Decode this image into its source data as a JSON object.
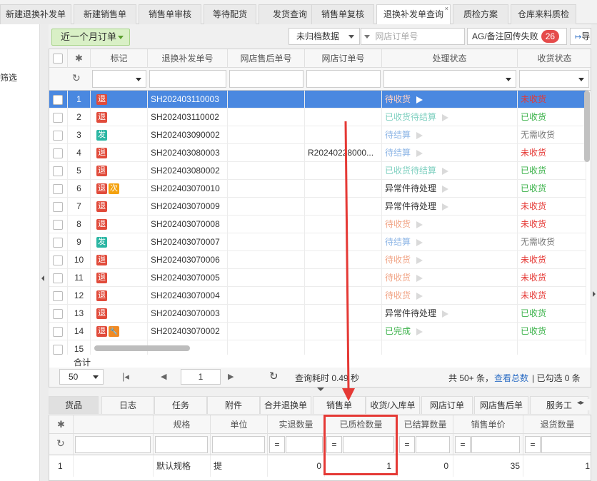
{
  "top_tabs": [
    {
      "label": "新建退换补发单"
    },
    {
      "label": "新建销售单"
    },
    {
      "label": "销售单审核"
    },
    {
      "label": "等待配货"
    },
    {
      "label": "发货查询"
    },
    {
      "label": "销售单复核"
    },
    {
      "label": "退换补发单查询",
      "active": true
    },
    {
      "label": "质检方案"
    },
    {
      "label": "仓库来料质检"
    }
  ],
  "close_glyph": "×",
  "left_panel": {
    "label": "筛选"
  },
  "toolbar": {
    "period_label": "近一个月订单",
    "archive_select": "未归档数据",
    "order_search_placeholder": "网店订单号",
    "ag_label": "AG/备注回传失败",
    "ag_count": "26",
    "right_button_label": "导"
  },
  "table": {
    "headers": {
      "mark": "标记",
      "order_no": "退换补发单号",
      "after_sale_no": "网店售后单号",
      "web_order_no": "网店订单号",
      "process_status": "处理状态",
      "receipt_status": "收货状态"
    },
    "tag_colors": {
      "退": "#e14b3b",
      "发": "#2bb6a3",
      "次": "#f4a20f",
      "wrench": "#f08a24"
    },
    "status_colors": {
      "待收货": "#f1a586",
      "已收货待结算": "#7fd0c0",
      "待结算": "#8eb6e6",
      "异常件待处理": "#333333",
      "已完成": "#3bb24a",
      "未收货": "#e53935",
      "已收货": "#3bb24a",
      "无需收货": "#777777"
    },
    "rows": [
      {
        "num": "1",
        "tags": [
          "退"
        ],
        "order_no": "SH202403110003",
        "after_sale_no": "",
        "web_order_no": "",
        "status": "待收货",
        "receipt": "未收货",
        "selected": true
      },
      {
        "num": "2",
        "tags": [
          "退"
        ],
        "order_no": "SH202403110002",
        "after_sale_no": "",
        "web_order_no": "",
        "status": "已收货待结算",
        "receipt": "已收货"
      },
      {
        "num": "3",
        "tags": [
          "发"
        ],
        "order_no": "SH202403090002",
        "after_sale_no": "",
        "web_order_no": "",
        "status": "待结算",
        "receipt": "无需收货"
      },
      {
        "num": "4",
        "tags": [
          "退"
        ],
        "order_no": "SH202403080003",
        "after_sale_no": "",
        "web_order_no": "R20240228000...",
        "status": "待结算",
        "receipt": "未收货"
      },
      {
        "num": "5",
        "tags": [
          "退"
        ],
        "order_no": "SH202403080002",
        "after_sale_no": "",
        "web_order_no": "",
        "status": "已收货待结算",
        "receipt": "已收货"
      },
      {
        "num": "6",
        "tags": [
          "退",
          "次"
        ],
        "order_no": "SH202403070010",
        "after_sale_no": "",
        "web_order_no": "",
        "status": "异常件待处理",
        "receipt": "已收货"
      },
      {
        "num": "7",
        "tags": [
          "退"
        ],
        "order_no": "SH202403070009",
        "after_sale_no": "",
        "web_order_no": "",
        "status": "异常件待处理",
        "receipt": "未收货"
      },
      {
        "num": "8",
        "tags": [
          "退"
        ],
        "order_no": "SH202403070008",
        "after_sale_no": "",
        "web_order_no": "",
        "status": "待收货",
        "receipt": "未收货"
      },
      {
        "num": "9",
        "tags": [
          "发"
        ],
        "order_no": "SH202403070007",
        "after_sale_no": "",
        "web_order_no": "",
        "status": "待结算",
        "receipt": "无需收货"
      },
      {
        "num": "10",
        "tags": [
          "退"
        ],
        "order_no": "SH202403070006",
        "after_sale_no": "",
        "web_order_no": "",
        "status": "待收货",
        "receipt": "未收货"
      },
      {
        "num": "11",
        "tags": [
          "退"
        ],
        "order_no": "SH202403070005",
        "after_sale_no": "",
        "web_order_no": "",
        "status": "待收货",
        "receipt": "未收货"
      },
      {
        "num": "12",
        "tags": [
          "退"
        ],
        "order_no": "SH202403070004",
        "after_sale_no": "",
        "web_order_no": "",
        "status": "待收货",
        "receipt": "未收货"
      },
      {
        "num": "13",
        "tags": [
          "退"
        ],
        "order_no": "SH202403070003",
        "after_sale_no": "",
        "web_order_no": "",
        "status": "异常件待处理",
        "receipt": "已收货"
      },
      {
        "num": "14",
        "tags": [
          "退",
          "wrench"
        ],
        "order_no": "SH202403070002",
        "after_sale_no": "",
        "web_order_no": "",
        "status": "已完成",
        "receipt": "已收货"
      },
      {
        "num": "15",
        "tags": [],
        "order_no": "",
        "after_sale_no": "",
        "web_order_no": "",
        "status": "",
        "receipt": ""
      }
    ],
    "summary_label": "合计"
  },
  "pager": {
    "page_size": "50",
    "page": "1",
    "query_time": "查询耗时 0.49 秒",
    "total": "共 50+ 条，",
    "view_total": "查看总数",
    "checked": "| 已勾选 0 条"
  },
  "bottom_tabs": [
    "货品",
    "日志",
    "任务",
    "附件",
    "合并退换单",
    "销售单",
    "收货/入库单",
    "网店订单",
    "网店售后单",
    "服务工"
  ],
  "bottom_table": {
    "headers": [
      "规格",
      "单位",
      "实退数量",
      "已质检数量",
      "已结算数量",
      "销售单价",
      "退货数量"
    ],
    "filter_eq": "=",
    "row": {
      "num": "1",
      "spec": "默认规格",
      "unit": "提",
      "actual_return": "0",
      "inspected": "1",
      "settled": "0",
      "unit_price": "35",
      "return_qty": "1"
    }
  }
}
